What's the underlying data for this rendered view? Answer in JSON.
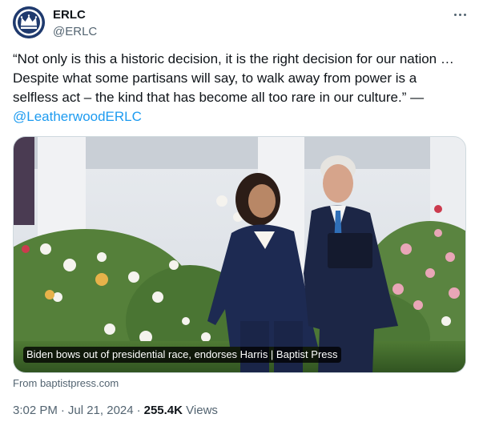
{
  "author": {
    "name": "ERLC",
    "handle": "@ERLC",
    "avatar_icon": "erlc-crown-logo-icon"
  },
  "menu": {
    "more_icon": "more-options-icon"
  },
  "tweet": {
    "text": "“Not only is this a historic decision, it is the right decision for our nation … Despite what some partisans will say, to walk away from power is a selfless act – the kind that has become all too rare in our culture.” — ",
    "mention": "@LeatherwoodERLC"
  },
  "card": {
    "caption": "Biden bows out of presidential race, endorses Harris | Baptist Press",
    "source": "From baptistpress.com"
  },
  "meta": {
    "time": "3:02 PM",
    "separator": "·",
    "date": "Jul 21, 2024",
    "views_count": "255.4K",
    "views_label": "Views"
  },
  "colors": {
    "accent": "#1d9bf0",
    "text": "#0f1419",
    "muted": "#536471",
    "avatar_bg": "#1f3a6e"
  }
}
